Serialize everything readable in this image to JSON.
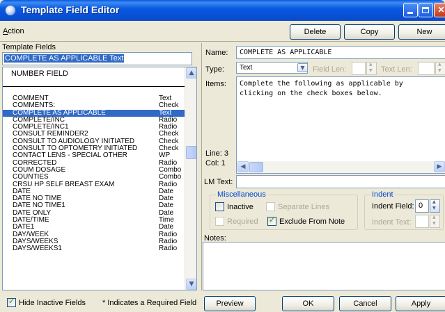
{
  "window": {
    "title": "Template Field Editor",
    "controls": {
      "minimize": "minimize",
      "maximize": "maximize",
      "close": "✕"
    }
  },
  "menu": {
    "action_label": "Action",
    "action_mnemonic": "A",
    "action_rest": "ction"
  },
  "toolbar": {
    "delete_label": "Delete",
    "copy_label": "Copy",
    "new_label": "New"
  },
  "template_fields": {
    "label": "Template Fields",
    "selected_value": "COMPLETE AS APPLICABLE  Text",
    "list_header": "NUMBER FIELD",
    "rows": [
      {
        "name": "COMMENT",
        "type": "Text"
      },
      {
        "name": "COMMENTS:",
        "type": "Check"
      },
      {
        "name": "COMPLETE AS APPLICABLE",
        "type": "Text",
        "selected": true
      },
      {
        "name": "COMPLETE/INC",
        "type": "Radio"
      },
      {
        "name": "COMPLETE/INC1",
        "type": "Radio"
      },
      {
        "name": "CONSULT REMINDER2",
        "type": "Check"
      },
      {
        "name": "CONSULT TO AUDIOLOGY INITIATED",
        "type": "Check"
      },
      {
        "name": "CONSULT TO OPTOMETRY INITIATED",
        "type": "Check"
      },
      {
        "name": "CONTACT LENS - SPECIAL OTHER",
        "type": "WP"
      },
      {
        "name": "CORRECTED",
        "type": "Radio"
      },
      {
        "name": "COUM DOSAGE",
        "type": "Combo"
      },
      {
        "name": "COUNTIES",
        "type": "Combo"
      },
      {
        "name": "CRSU HP SELF BREAST EXAM",
        "type": "Radio"
      },
      {
        "name": "DATE",
        "type": "Date"
      },
      {
        "name": "DATE NO TIME",
        "type": "Date"
      },
      {
        "name": "DATE NO TIME1",
        "type": "Date"
      },
      {
        "name": "DATE ONLY",
        "type": "Date"
      },
      {
        "name": "DATE/TIME",
        "type": "Time"
      },
      {
        "name": "DATE1",
        "type": "Date"
      },
      {
        "name": "DAY/WEEK",
        "type": "Radio"
      },
      {
        "name": "DAYS/WEEKS",
        "type": "Radio"
      },
      {
        "name": "DAYS/WEEKS1",
        "type": "Radio"
      }
    ]
  },
  "footer_left": {
    "hide_inactive_label": "Hide Inactive Fields",
    "hide_inactive_checked": true,
    "required_note": "* Indicates a Required Field"
  },
  "editor": {
    "name_label": "Name:",
    "name_value": "COMPLETE AS APPLICABLE",
    "type_label": "Type:",
    "type_value": "Text",
    "field_len_label": "Field Len:",
    "text_len_label": "Text Len:",
    "items_label": "Items:",
    "items_text": "Complete the following as applicable by\nclicking on the check boxes below.",
    "line_label": "Line: 3",
    "col_label": "Col: 1",
    "lm_text_label": "LM Text:"
  },
  "miscellaneous": {
    "title": "Miscellaneous",
    "inactive_label": "Inactive",
    "inactive_checked": false,
    "separate_lines_label": "Separate Lines",
    "required_label": "Required",
    "exclude_label": "Exclude From Note",
    "exclude_checked": true
  },
  "indent": {
    "title": "Indent",
    "indent_field_label": "Indent Field:",
    "indent_field_value": "0",
    "indent_text_label": "Indent Text:"
  },
  "notes_label": "Notes:",
  "footer_buttons": {
    "preview": "Preview",
    "ok": "OK",
    "cancel": "Cancel",
    "apply": "Apply"
  },
  "colors": {
    "titlebar": "#0a5ae0",
    "selection": "#316ac5",
    "window_bg": "#ece9d8",
    "group_title": "#0046d5"
  }
}
